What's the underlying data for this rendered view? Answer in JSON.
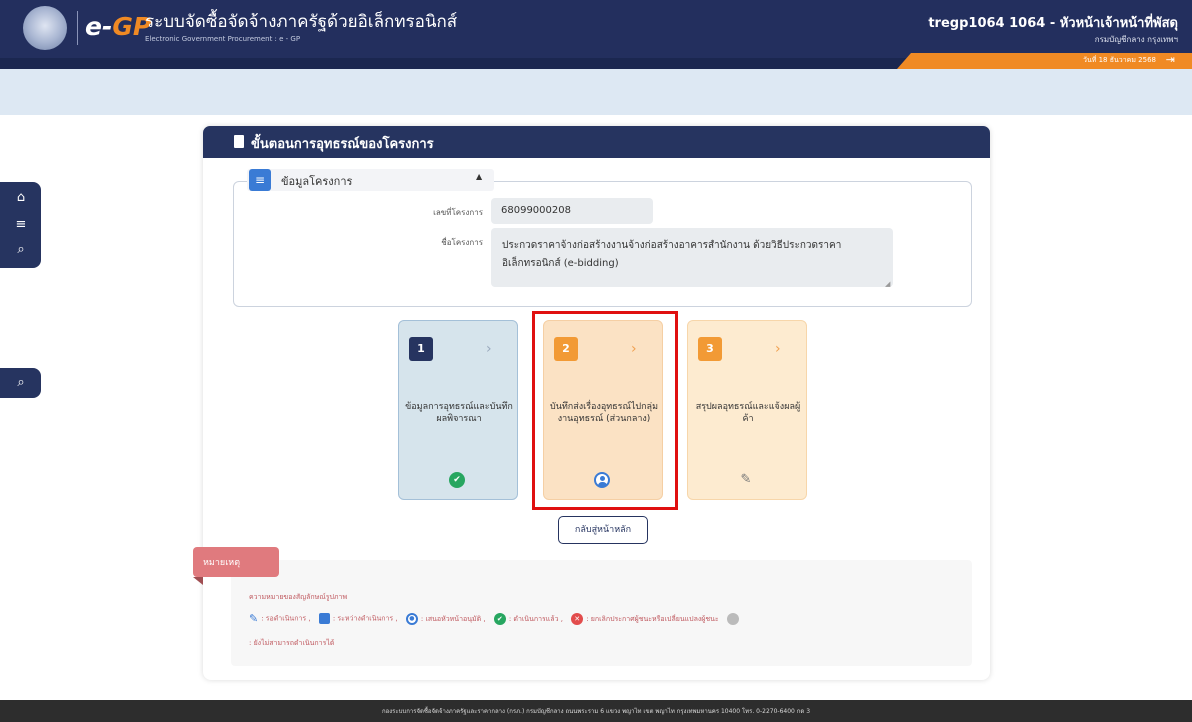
{
  "header": {
    "brand_e": "e-",
    "brand_gp": "GP",
    "title_th": "ระบบจัดซื้อจัดจ้างภาครัฐด้วยอิเล็กทรอนิกส์",
    "title_en": "Electronic Government Procurement : e - GP",
    "user_name": "tregp1064 1064 - หัวหน้าเจ้าหน้าที่พัสดุ",
    "user_dept": "กรมบัญชีกลาง กรุงเทพฯ",
    "date": "วันที่ 18 ธันวาคม 2568"
  },
  "card": {
    "title": "ขั้นตอนการอุทธรณ์ของโครงการ",
    "section_title": "ข้อมูลโครงการ",
    "project_no_label": "เลขที่โครงการ",
    "project_no_value": "68099000208",
    "project_name_label": "ชื่อโครงการ",
    "project_name_value": "ประกวดราคาจ้างก่อสร้างงานจ้างก่อสร้างอาคารสำนักงาน ด้วยวิธีประกวดราคาอิเล็กทรอนิกส์ (e-bidding)"
  },
  "steps": [
    {
      "num": "1",
      "label": "ข้อมูลการอุทธรณ์และบันทึกผลพิจารณา",
      "icon": "check-circle-icon",
      "state": "done"
    },
    {
      "num": "2",
      "label": "บันทึกส่งเรื่องอุทธรณ์ไปกลุ่มงานอุทธรณ์ (ส่วนกลาง)",
      "icon": "user-circle-icon",
      "state": "pending-approval"
    },
    {
      "num": "3",
      "label": "สรุปผลอุทธรณ์และแจ้งผลผู้ค้า",
      "icon": "edit-icon",
      "state": "todo"
    }
  ],
  "back_button": "กลับสู่หน้าหลัก",
  "notes": {
    "tab_label": "หมายเหตุ",
    "heading": "ความหมายของสัญลักษณ์รูปภาพ",
    "legend": [
      {
        "icon": "edit-icon",
        "text": ": รอดำเนินการ ,"
      },
      {
        "icon": "save-icon",
        "text": ": ระหว่างดำเนินการ ,"
      },
      {
        "icon": "user-circle-icon",
        "text": ": เสนอหัวหน้าอนุมัติ ,"
      },
      {
        "icon": "check-circle-icon",
        "text": ": ดำเนินการแล้ว ,"
      },
      {
        "icon": "cancel-circle-icon",
        "text": ": ยกเลิกประกาศผู้ชนะหรือเปลี่ยนแปลงผู้ชนะ"
      },
      {
        "icon": "grey-circle-icon",
        "text": ""
      }
    ],
    "legend_last": ": ยังไม่สามารถดำเนินการได้"
  },
  "footer": "กองระบบการจัดซื้อจัดจ้างภาครัฐและราคากลาง (กรภ.) กรมบัญชีกลาง ถนนพระราม 6 แขวง พญาไท เขต พญาไท กรุงเทพมหานคร 10400 โทร. 0-2270-6400 กด 3",
  "colors": {
    "navy": "#263460",
    "orange": "#f08a24",
    "highlight": "#e01010",
    "done": "#27a660"
  }
}
